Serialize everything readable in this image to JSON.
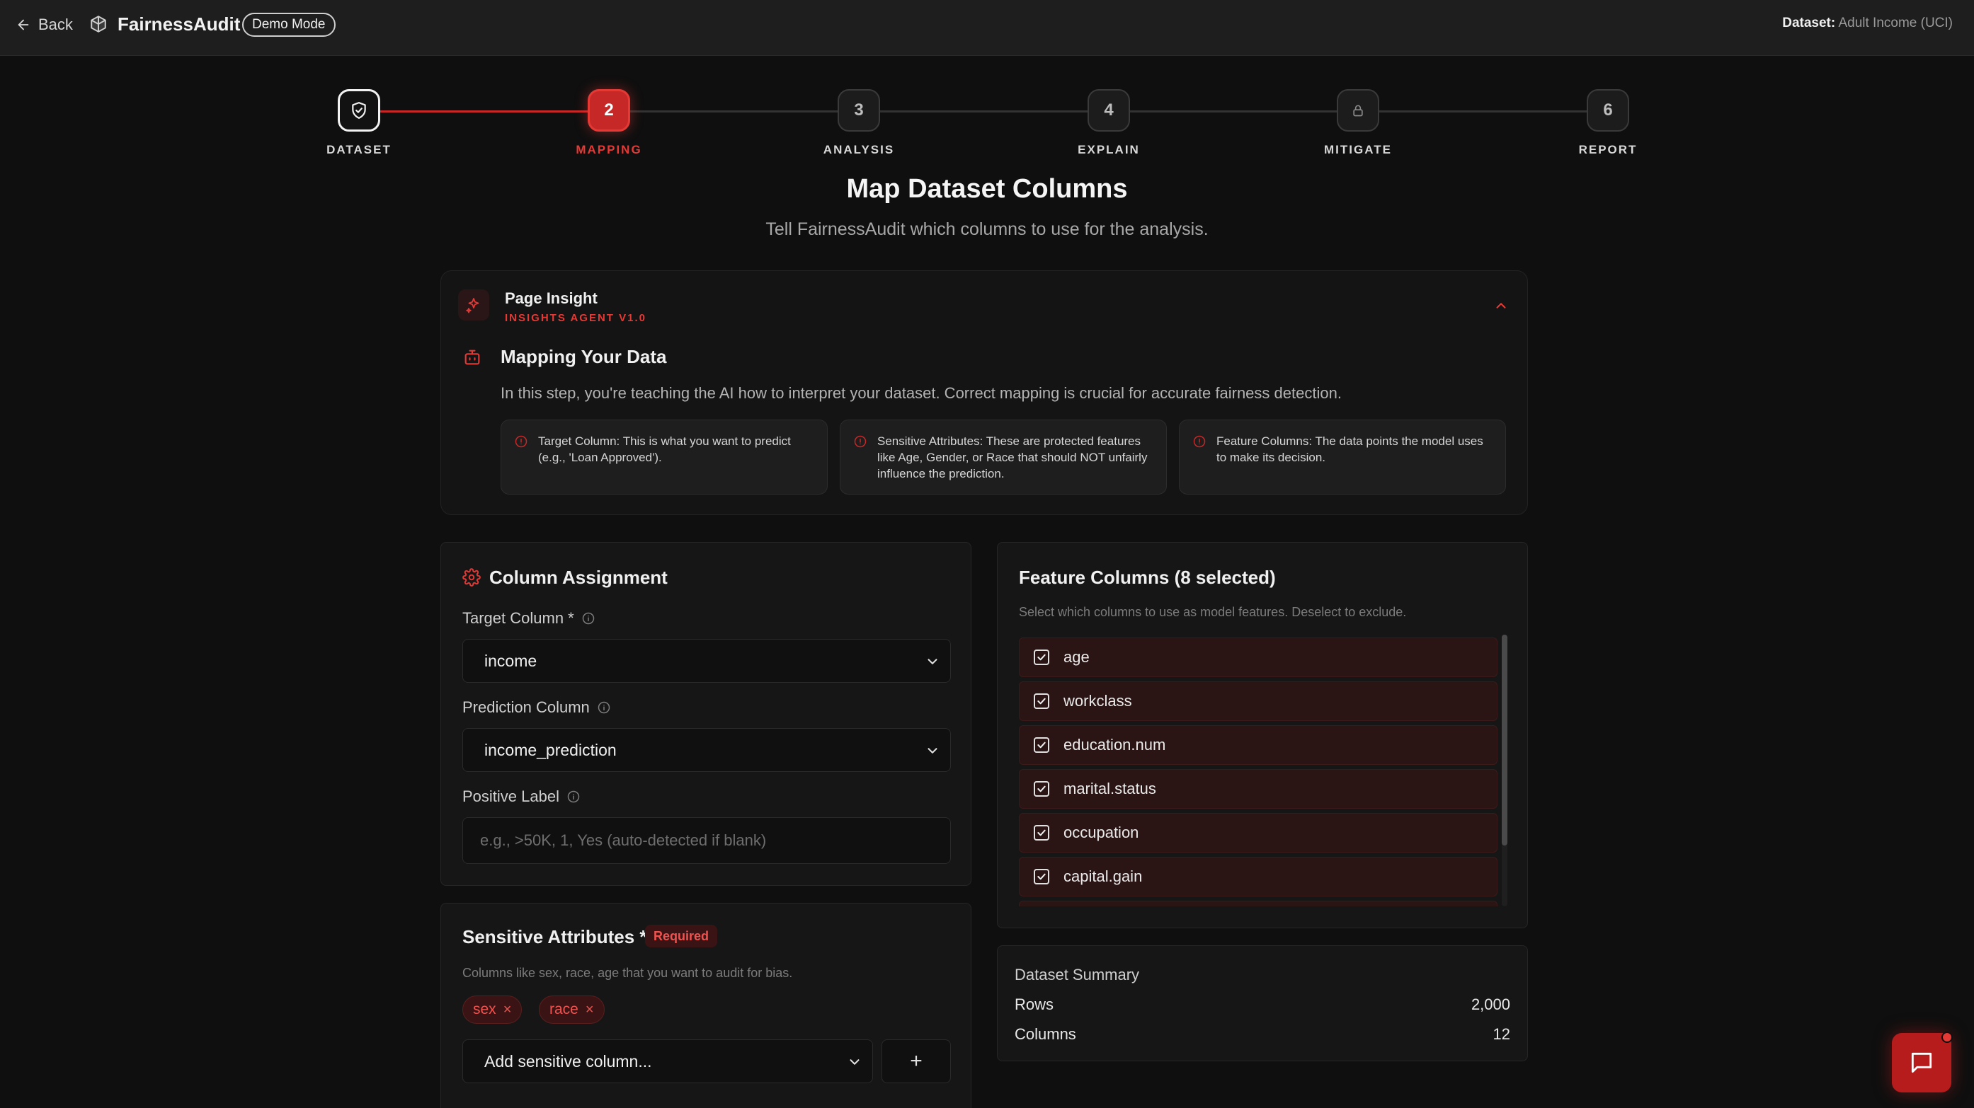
{
  "topbar": {
    "back_label": "Back",
    "brand": "FairnessAudit",
    "mode_badge": "Demo Mode",
    "dataset_prefix": "Dataset:",
    "dataset_name": "Adult Income (UCI)"
  },
  "stepper": {
    "steps": [
      {
        "number": "",
        "label": "DATASET",
        "state": "done",
        "icon": "shield-check-icon"
      },
      {
        "number": "2",
        "label": "MAPPING",
        "state": "current"
      },
      {
        "number": "3",
        "label": "ANALYSIS",
        "state": "upcoming"
      },
      {
        "number": "4",
        "label": "EXPLAIN",
        "state": "upcoming"
      },
      {
        "number": "",
        "label": "MITIGATE",
        "state": "locked",
        "icon": "lock-icon"
      },
      {
        "number": "6",
        "label": "REPORT",
        "state": "upcoming"
      }
    ]
  },
  "page": {
    "title": "Map Dataset Columns",
    "subtitle": "Tell FairnessAudit which columns to use for the analysis."
  },
  "insight": {
    "title": "Page Insight",
    "agent": "INSIGHTS AGENT V1.0",
    "heading": "Mapping Your Data",
    "description": "In this step, you're teaching the AI how to interpret your dataset. Correct mapping is crucial for accurate fairness detection.",
    "tips": [
      "Target Column: This is what you want to predict (e.g., 'Loan Approved').",
      "Sensitive Attributes: These are protected features like Age, Gender, or Race that should NOT unfairly influence the prediction.",
      "Feature Columns: The data points the model uses to make its decision."
    ]
  },
  "column_assignment": {
    "title": "Column Assignment",
    "target_label": "Target Column *",
    "target_value": "income",
    "prediction_label": "Prediction Column",
    "prediction_value": "income_prediction",
    "positive_label": "Positive Label",
    "positive_placeholder": "e.g., >50K, 1, Yes (auto-detected if blank)"
  },
  "sensitive": {
    "title": "Sensitive Attributes *",
    "required_badge": "Required",
    "help": "Columns like sex, race, age that you want to audit for bias.",
    "chips": [
      "sex",
      "race"
    ],
    "add_placeholder": "Add sensitive column...",
    "add_button": "+"
  },
  "features": {
    "title": "Feature Columns (8 selected)",
    "help": "Select which columns to use as model features. Deselect to exclude.",
    "items": [
      "age",
      "workclass",
      "education.num",
      "marital.status",
      "occupation",
      "capital.gain"
    ]
  },
  "summary": {
    "title": "Dataset Summary",
    "rows_label": "Rows",
    "rows_value": "2,000",
    "columns_label": "Columns",
    "columns_value": "12"
  },
  "colors": {
    "accent": "#e53935",
    "accent_dark": "#c62828",
    "background": "#0f0f0f",
    "panel": "#161616"
  }
}
